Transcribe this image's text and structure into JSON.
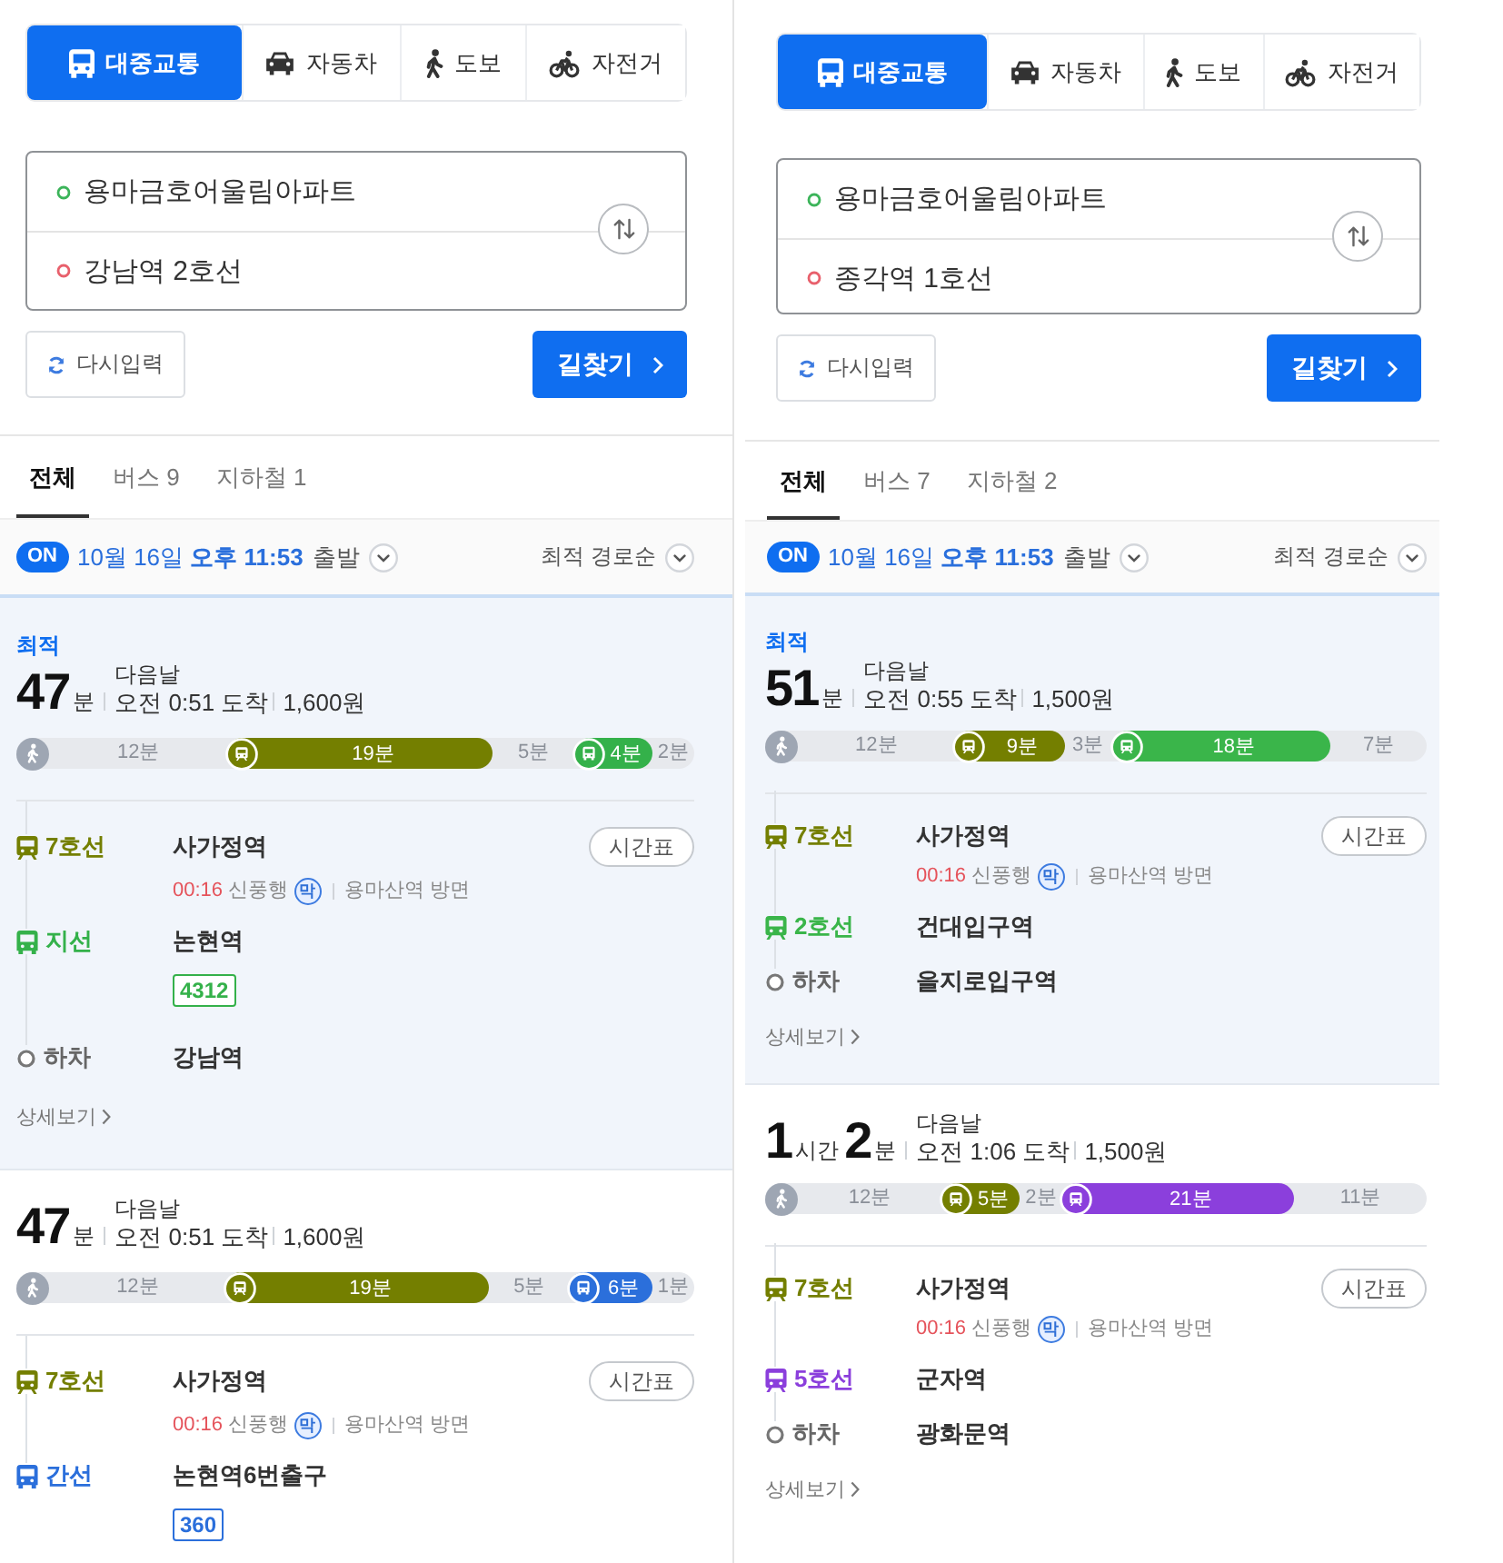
{
  "panels": [
    {
      "modes": [
        {
          "kind": "transit",
          "label": "대중교통",
          "selected": true
        },
        {
          "kind": "car",
          "label": "자동차",
          "selected": false
        },
        {
          "kind": "walk",
          "label": "도보",
          "selected": false
        },
        {
          "kind": "bike",
          "label": "자전거",
          "selected": false
        }
      ],
      "origin": "용마금호어울림아파트",
      "destination": "강남역 2호선",
      "reset_button": "다시입력",
      "search_button": "길찾기",
      "filter_tabs": [
        {
          "label": "전체",
          "selected": true
        },
        {
          "label": "버스 9",
          "selected": false
        },
        {
          "label": "지하철 1",
          "selected": false
        }
      ],
      "realtime_badge": "ON",
      "departure_time": "10월 16일 **오후 11:53**",
      "departure_label": "출발",
      "sort": "최적 경로순",
      "routes": [
        {
          "selected": true,
          "best_label": "최적",
          "duration": [
            {
              "num": "47",
              "unit": "분"
            }
          ],
          "next_day": "다음날",
          "arrival": "오전 0:51 도착",
          "fare": "1,600원",
          "timeline": [
            {
              "kind": "walk",
              "label": "12분"
            },
            {
              "kind": "subway",
              "label": "19분",
              "color": "#747f00"
            },
            {
              "kind": "walk",
              "label": "5분"
            },
            {
              "kind": "bus",
              "label": "4분",
              "color": "#34b14a"
            },
            {
              "kind": "walk",
              "label": "2분"
            }
          ],
          "steps": [
            {
              "kind": "subway",
              "line": "7호선",
              "color": "#747f00",
              "station": "사가정역",
              "timetable_button": "시간표",
              "departure": {
                "time": "00:16",
                "direction": "신풍행",
                "last_train_badge": "막",
                "platform": "용마산역 방면"
              }
            },
            {
              "kind": "bus",
              "line": "지선",
              "color": "#34b14a",
              "station": "논현역",
              "bus_number": "4312"
            },
            {
              "kind": "alight",
              "line": "하차",
              "station": "강남역"
            }
          ],
          "detail_link": "상세보기"
        },
        {
          "selected": false,
          "duration": [
            {
              "num": "47",
              "unit": "분"
            }
          ],
          "next_day": "다음날",
          "arrival": "오전 0:51 도착",
          "fare": "1,600원",
          "timeline": [
            {
              "kind": "walk",
              "label": "12분"
            },
            {
              "kind": "subway",
              "label": "19분",
              "color": "#747f00"
            },
            {
              "kind": "walk",
              "label": "5분"
            },
            {
              "kind": "bus",
              "label": "6분",
              "color": "#2b6fdb"
            },
            {
              "kind": "walk",
              "label": "1분"
            }
          ],
          "steps": [
            {
              "kind": "subway",
              "line": "7호선",
              "color": "#747f00",
              "station": "사가정역",
              "timetable_button": "시간표",
              "departure": {
                "time": "00:16",
                "direction": "신풍행",
                "last_train_badge": "막",
                "platform": "용마산역 방면"
              }
            },
            {
              "kind": "bus",
              "line": "간선",
              "color": "#2b6fdb",
              "station": "논현역6번출구",
              "bus_number": "360"
            }
          ]
        }
      ]
    },
    {
      "modes": [
        {
          "kind": "transit",
          "label": "대중교통",
          "selected": true
        },
        {
          "kind": "car",
          "label": "자동차",
          "selected": false
        },
        {
          "kind": "walk",
          "label": "도보",
          "selected": false
        },
        {
          "kind": "bike",
          "label": "자전거",
          "selected": false
        }
      ],
      "origin": "용마금호어울림아파트",
      "destination": "종각역 1호선",
      "reset_button": "다시입력",
      "search_button": "길찾기",
      "filter_tabs": [
        {
          "label": "전체",
          "selected": true
        },
        {
          "label": "버스 7",
          "selected": false
        },
        {
          "label": "지하철 2",
          "selected": false
        }
      ],
      "realtime_badge": "ON",
      "departure_time": "10월 16일 **오후 11:53**",
      "departure_label": "출발",
      "sort": "최적 경로순",
      "routes": [
        {
          "selected": true,
          "best_label": "최적",
          "duration": [
            {
              "num": "51",
              "unit": "분"
            }
          ],
          "next_day": "다음날",
          "arrival": "오전 0:55 도착",
          "fare": "1,500원",
          "timeline": [
            {
              "kind": "walk",
              "label": "12분"
            },
            {
              "kind": "subway",
              "label": "9분",
              "color": "#747f00"
            },
            {
              "kind": "walk",
              "label": "3분"
            },
            {
              "kind": "subway",
              "label": "18분",
              "color": "#3ab54a"
            },
            {
              "kind": "walk",
              "label": "7분"
            }
          ],
          "steps": [
            {
              "kind": "subway",
              "line": "7호선",
              "color": "#747f00",
              "station": "사가정역",
              "timetable_button": "시간표",
              "departure": {
                "time": "00:16",
                "direction": "신풍행",
                "last_train_badge": "막",
                "platform": "용마산역 방면"
              }
            },
            {
              "kind": "subway",
              "line": "2호선",
              "color": "#3ab54a",
              "station": "건대입구역"
            },
            {
              "kind": "alight",
              "line": "하차",
              "station": "을지로입구역"
            }
          ],
          "detail_link": "상세보기"
        },
        {
          "selected": false,
          "duration": [
            {
              "num": "1",
              "unit": "시간"
            },
            {
              "num": "2",
              "unit": "분"
            }
          ],
          "next_day": "다음날",
          "arrival": "오전 1:06 도착",
          "fare": "1,500원",
          "timeline": [
            {
              "kind": "walk",
              "label": "12분"
            },
            {
              "kind": "subway",
              "label": "5분",
              "color": "#747f00"
            },
            {
              "kind": "walk",
              "label": "2분"
            },
            {
              "kind": "subway",
              "label": "21분",
              "color": "#8b3fdc"
            },
            {
              "kind": "walk",
              "label": "11분"
            }
          ],
          "steps": [
            {
              "kind": "subway",
              "line": "7호선",
              "color": "#747f00",
              "station": "사가정역",
              "timetable_button": "시간표",
              "departure": {
                "time": "00:16",
                "direction": "신풍행",
                "last_train_badge": "막",
                "platform": "용마산역 방면"
              }
            },
            {
              "kind": "subway",
              "line": "5호선",
              "color": "#8b3fdc",
              "station": "군자역"
            },
            {
              "kind": "alight",
              "line": "하차",
              "station": "광화문역"
            }
          ],
          "detail_link": "상세보기"
        }
      ]
    }
  ]
}
